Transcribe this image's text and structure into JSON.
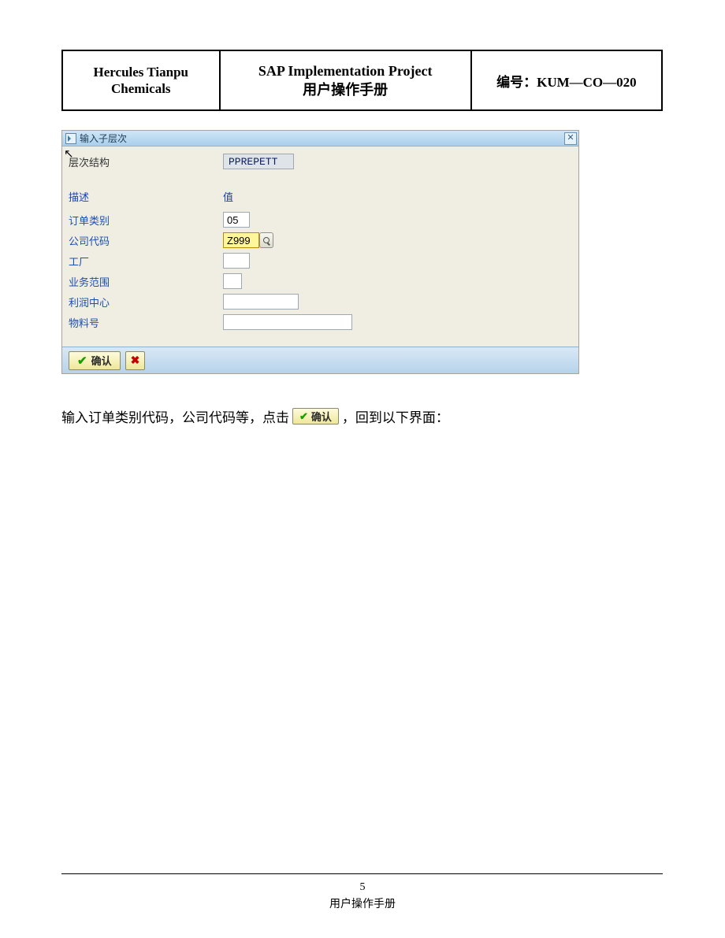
{
  "header": {
    "company": "Hercules Tianpu\nChemicals",
    "project_line1": "SAP Implementation Project",
    "project_line2": "用户操作手册",
    "doc_no_label": "编号：",
    "doc_no_value": "KUM—CO—020"
  },
  "sap": {
    "dialog_title": "输入子层次",
    "hierarchy_label": "层次结构",
    "hierarchy_value": "PPREPETT",
    "col_desc": "描述",
    "col_val": "值",
    "fields": {
      "order_type": {
        "label": "订单类别",
        "value": "05",
        "width": 34
      },
      "company_code": {
        "label": "公司代码",
        "value": "Z999",
        "width": 46,
        "active": true,
        "f4": true
      },
      "plant": {
        "label": "工厂",
        "value": "",
        "width": 34
      },
      "bus_area": {
        "label": "业务范围",
        "value": "",
        "width": 24
      },
      "profit_ctr": {
        "label": "利润中心",
        "value": "",
        "width": 96
      },
      "material": {
        "label": "物料号",
        "value": "",
        "width": 164
      }
    },
    "confirm_label": "确认"
  },
  "instruction": {
    "before": "输入订单类别代码，公司代码等，点击",
    "button_label": "确认",
    "after": "，回到以下界面："
  },
  "footer": {
    "page": "5",
    "text": "用户操作手册"
  }
}
